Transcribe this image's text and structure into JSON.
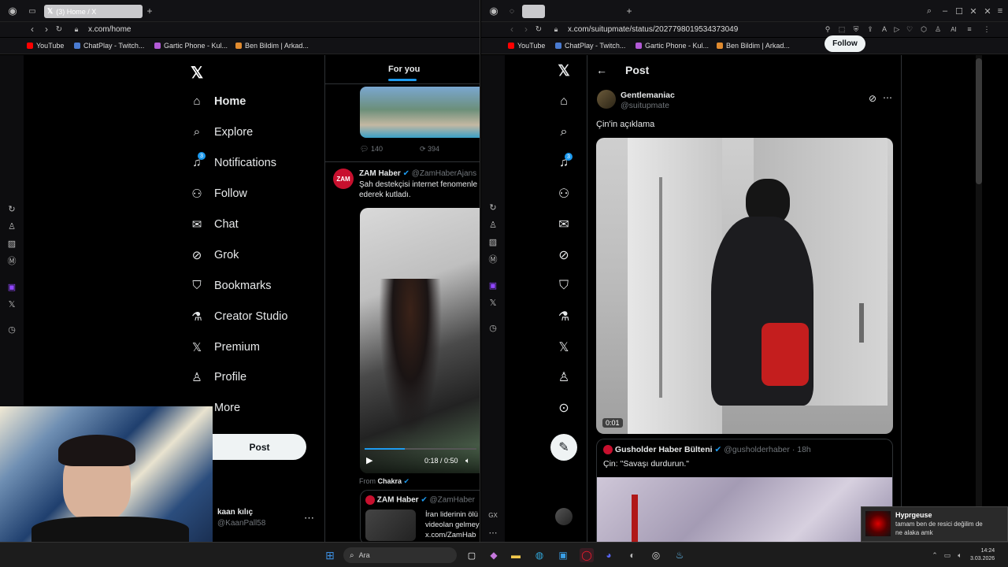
{
  "left": {
    "tab_title": "(3) Home / X",
    "url": "x.com/home",
    "bookmarks": [
      "YouTube",
      "ChatPlay - Twitch...",
      "Gartic Phone - Kul...",
      "Ben Bildim | Arkad..."
    ],
    "nav": [
      {
        "label": "Home",
        "icon": "home-icon"
      },
      {
        "label": "Explore",
        "icon": "search-icon"
      },
      {
        "label": "Notifications",
        "icon": "bell-icon"
      },
      {
        "label": "Follow",
        "icon": "person-add-icon"
      },
      {
        "label": "Chat",
        "icon": "mail-icon"
      },
      {
        "label": "Grok",
        "icon": "grok-icon"
      },
      {
        "label": "Bookmarks",
        "icon": "bookmark-icon"
      },
      {
        "label": "Creator Studio",
        "icon": "flask-icon"
      },
      {
        "label": "Premium",
        "icon": "x-icon"
      },
      {
        "label": "Profile",
        "icon": "person-icon"
      },
      {
        "label": "More",
        "icon": "more-icon"
      }
    ],
    "notif_badge": "3",
    "post_button": "Post",
    "account_name": "kaan kılıç",
    "account_handle": "@KaanPall58",
    "feed": {
      "tab_for_you": "For you",
      "replies": "140",
      "reposts": "394",
      "tweet_author": "ZAM Haber",
      "tweet_handle": "@ZamHaberAjans",
      "tweet_text_1": "Şah destekçisi internet fenomenle",
      "tweet_text_2": "ederek kutladı.",
      "video_time": "0:18 / 0:50",
      "from_label": "From",
      "from_source": "Chakra",
      "quote_author": "ZAM Haber",
      "quote_handle": "@ZamHaber",
      "quote_text_1": "İran liderinin ölü",
      "quote_text_2": "videolan gelmey",
      "quote_text_3": "x.com/ZamHab"
    }
  },
  "right": {
    "url": "x.com/suitupmate/status/2027798019534373049",
    "bookmarks": [
      "YouTube",
      "ChatPlay - Twitch...",
      "Gartic Phone - Kul...",
      "Ben Bildim | Arkad..."
    ],
    "header_title": "Post",
    "author_name": "Gentlemaniac",
    "author_handle": "@suitupmate",
    "follow_label": "Follow",
    "post_text": "Çin'in açıklama",
    "video_time": "0:01",
    "reply_author": "Gusholder Haber Bülteni",
    "reply_handle": "@gusholderhaber · 18h",
    "reply_text": "Çin: \"Savaşı durdurun.\"",
    "notif_badge": "3",
    "gx_label": "GX"
  },
  "toast": {
    "title": "Hyprgeuse",
    "text_1": "tamam ben de resici değilim de",
    "text_2": "ne alaka amk"
  },
  "taskbar": {
    "search_placeholder": "Ara",
    "time": "14:24",
    "date": "3.03.2026"
  },
  "colors": {
    "accent": "#1d9bf0",
    "background": "#000000",
    "text": "#e7e9ea",
    "muted": "#71767b"
  }
}
